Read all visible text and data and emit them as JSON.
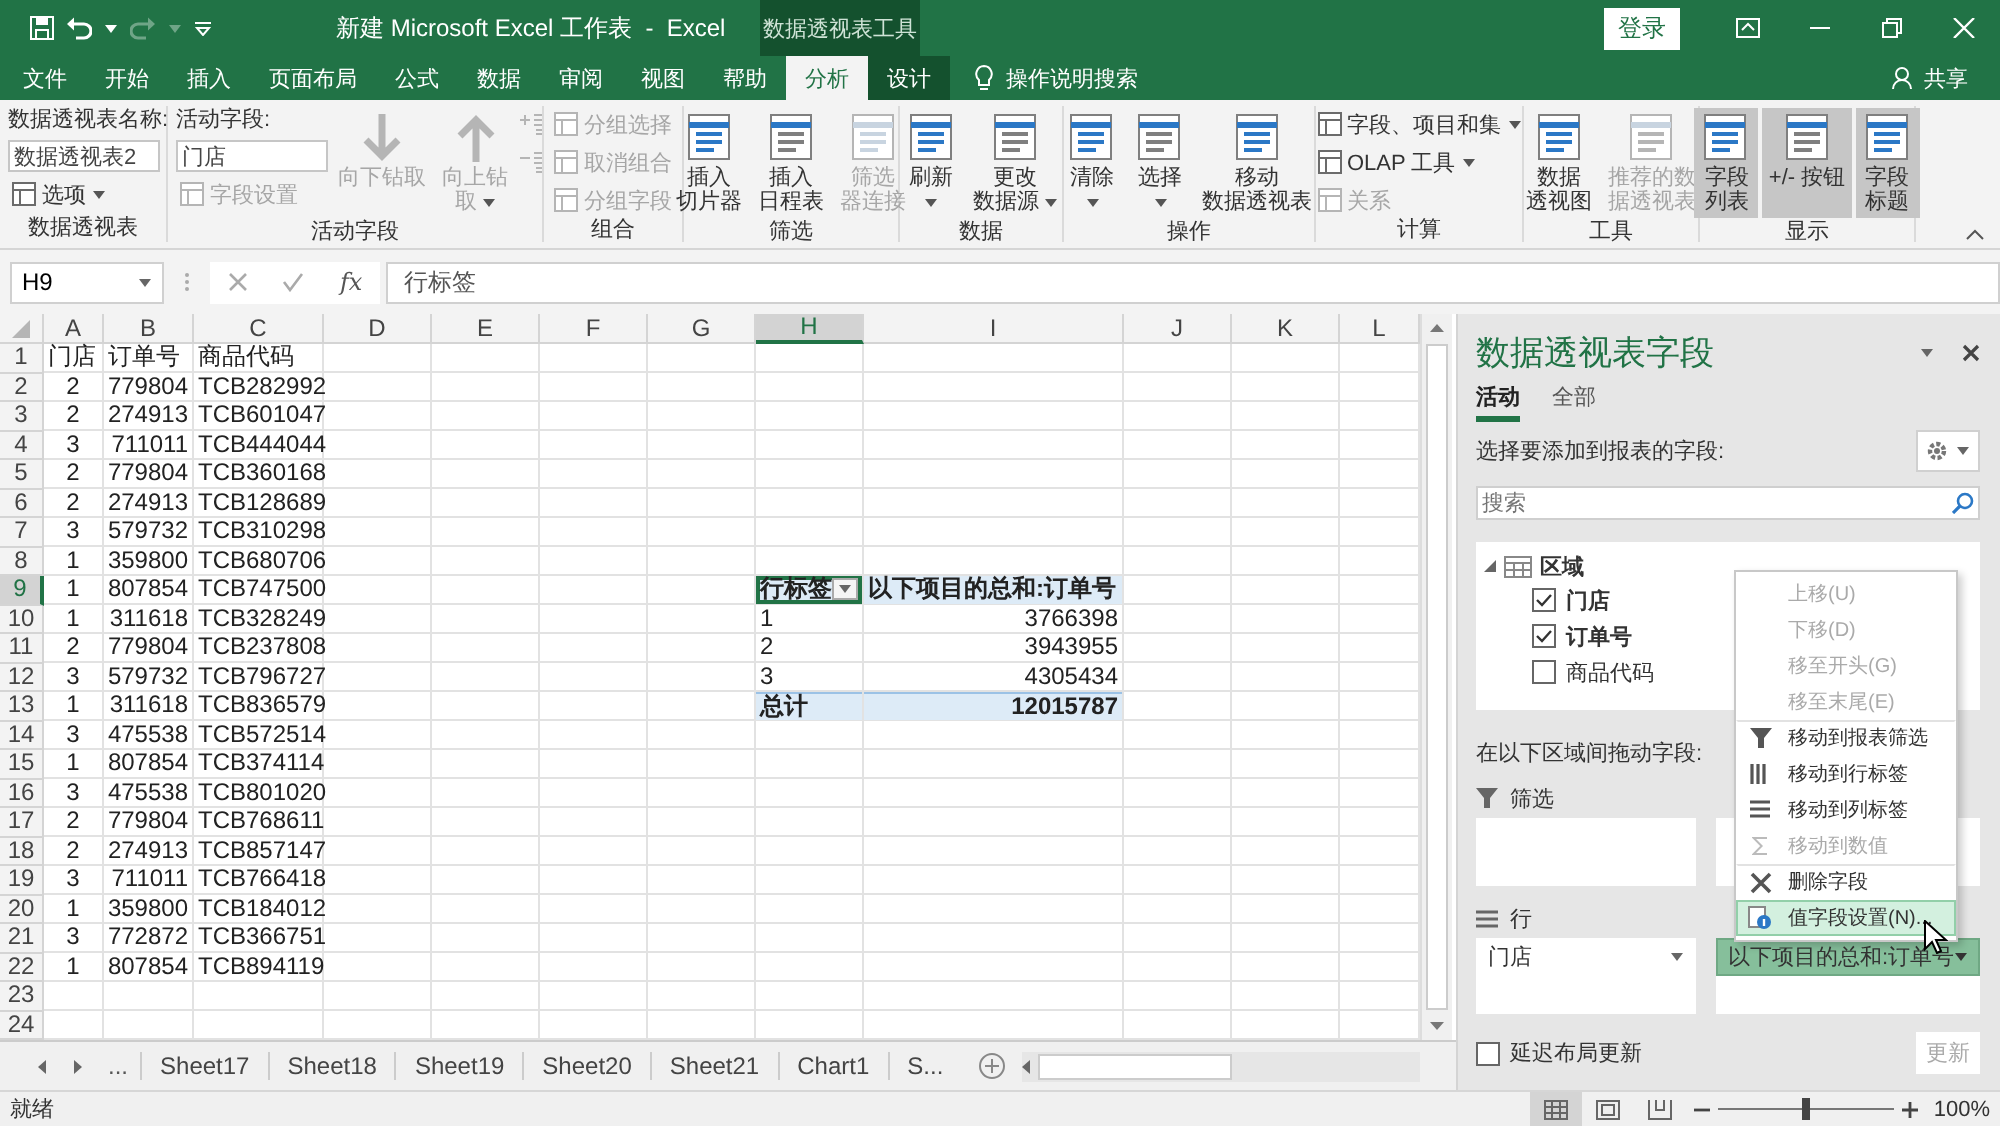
{
  "title_bar": {
    "title": "新建 Microsoft Excel 工作表  -  Excel",
    "contextual_group": "数据透视表工具",
    "sign_in": "登录"
  },
  "ribbon_tabs": [
    {
      "label": "文件",
      "selected": false,
      "contextual": false
    },
    {
      "label": "开始",
      "selected": false,
      "contextual": false
    },
    {
      "label": "插入",
      "selected": false,
      "contextual": false
    },
    {
      "label": "页面布局",
      "selected": false,
      "contextual": false
    },
    {
      "label": "公式",
      "selected": false,
      "contextual": false
    },
    {
      "label": "数据",
      "selected": false,
      "contextual": false
    },
    {
      "label": "审阅",
      "selected": false,
      "contextual": false
    },
    {
      "label": "视图",
      "selected": false,
      "contextual": false
    },
    {
      "label": "帮助",
      "selected": false,
      "contextual": false
    },
    {
      "label": "分析",
      "selected": true,
      "contextual": true
    },
    {
      "label": "设计",
      "selected": false,
      "contextual": true
    }
  ],
  "tell_me": "操作说明搜索",
  "share": "共享",
  "ribbon_groups": [
    {
      "label": "数据透视表",
      "controls": [
        {
          "kind": "label",
          "label": "数据透视表名称:"
        },
        {
          "kind": "field",
          "value": "数据透视表2"
        },
        {
          "kind": "small",
          "label": "选项",
          "dropdown": true,
          "disabled": false,
          "on": false
        }
      ]
    },
    {
      "label": "活动字段",
      "controls": [
        {
          "kind": "label",
          "label": "活动字段:"
        },
        {
          "kind": "field",
          "value": "门店"
        },
        {
          "kind": "small",
          "label": "字段设置",
          "dropdown": false,
          "disabled": true,
          "on": false
        },
        {
          "kind": "drilldown",
          "label_lines": [
            "向下钻取"
          ],
          "dropdown": false,
          "disabled": true,
          "on": false
        },
        {
          "kind": "drillup",
          "label_lines": [
            "向上钻",
            "取"
          ],
          "dropdown": true,
          "disabled": true,
          "on": false
        },
        {
          "kind": "expand",
          "disabled": true
        },
        {
          "kind": "collapse",
          "disabled": true
        }
      ]
    },
    {
      "label": "组合",
      "controls": [
        {
          "kind": "small",
          "label": "分组选择",
          "dropdown": false,
          "disabled": true,
          "on": false
        },
        {
          "kind": "small",
          "label": "取消组合",
          "dropdown": false,
          "disabled": true,
          "on": false
        },
        {
          "kind": "small",
          "label": "分组字段",
          "dropdown": false,
          "disabled": true,
          "on": false
        }
      ]
    },
    {
      "label": "筛选",
      "controls": [
        {
          "kind": "large",
          "label_lines": [
            "插入",
            "切片器"
          ],
          "dropdown": false,
          "disabled": false,
          "on": false
        },
        {
          "kind": "large",
          "label_lines": [
            "插入",
            "日程表"
          ],
          "dropdown": false,
          "disabled": false,
          "on": false
        },
        {
          "kind": "large",
          "label_lines": [
            "筛选",
            "器连接"
          ],
          "dropdown": false,
          "disabled": true,
          "on": false
        }
      ]
    },
    {
      "label": "数据",
      "controls": [
        {
          "kind": "large",
          "label_lines": [
            "刷新"
          ],
          "dropdown": true,
          "disabled": false,
          "on": false
        },
        {
          "kind": "large",
          "label_lines": [
            "更改",
            "数据源"
          ],
          "dropdown": true,
          "disabled": false,
          "on": false
        }
      ]
    },
    {
      "label": "操作",
      "controls": [
        {
          "kind": "large",
          "label_lines": [
            "清除"
          ],
          "dropdown": true,
          "disabled": false,
          "on": false
        },
        {
          "kind": "large",
          "label_lines": [
            "选择"
          ],
          "dropdown": true,
          "disabled": false,
          "on": false
        },
        {
          "kind": "large",
          "label_lines": [
            "移动",
            "数据透视表"
          ],
          "dropdown": false,
          "disabled": false,
          "on": false
        }
      ]
    },
    {
      "label": "计算",
      "controls": [
        {
          "kind": "small",
          "label": "字段、项目和集",
          "dropdown": true,
          "disabled": false,
          "on": false
        },
        {
          "kind": "small",
          "label": "OLAP 工具",
          "dropdown": true,
          "disabled": false,
          "on": false
        },
        {
          "kind": "small",
          "label": "关系",
          "dropdown": false,
          "disabled": true,
          "on": false
        }
      ]
    },
    {
      "label": "工具",
      "controls": [
        {
          "kind": "large",
          "label_lines": [
            "数据",
            "透视图"
          ],
          "dropdown": false,
          "disabled": false,
          "on": false
        },
        {
          "kind": "large",
          "label_lines": [
            "推荐的数",
            "据透视表"
          ],
          "dropdown": false,
          "disabled": true,
          "on": false
        }
      ]
    },
    {
      "label": "显示",
      "controls": [
        {
          "kind": "large",
          "label_lines": [
            "字段",
            "列表"
          ],
          "dropdown": false,
          "disabled": false,
          "on": true
        },
        {
          "kind": "large",
          "label_lines": [
            "+/- 按钮"
          ],
          "dropdown": false,
          "disabled": false,
          "on": true
        },
        {
          "kind": "large",
          "label_lines": [
            "字段",
            "标题"
          ],
          "dropdown": false,
          "disabled": false,
          "on": true
        }
      ]
    }
  ],
  "formula_bar": {
    "name_box": "H9",
    "fx": "fx",
    "formula": "行标签"
  },
  "sheet": {
    "columns": [
      {
        "label": "A",
        "selected": false
      },
      {
        "label": "B",
        "selected": false
      },
      {
        "label": "C",
        "selected": false
      },
      {
        "label": "D",
        "selected": false
      },
      {
        "label": "E",
        "selected": false
      },
      {
        "label": "F",
        "selected": false
      },
      {
        "label": "G",
        "selected": false
      },
      {
        "label": "H",
        "selected": true
      },
      {
        "label": "I",
        "selected": false
      },
      {
        "label": "J",
        "selected": false
      },
      {
        "label": "K",
        "selected": false
      },
      {
        "label": "L",
        "selected": false
      }
    ],
    "rows": [
      {
        "number": "1",
        "selected": false,
        "kind": "header",
        "cells": {
          "A": "门店",
          "B": "订单号",
          "C": "商品代码"
        }
      },
      {
        "number": "2",
        "selected": false,
        "kind": "data",
        "cells": {
          "A": "2",
          "B": "779804",
          "C": "TCB282992"
        }
      },
      {
        "number": "3",
        "selected": false,
        "kind": "data",
        "cells": {
          "A": "2",
          "B": "274913",
          "C": "TCB601047"
        }
      },
      {
        "number": "4",
        "selected": false,
        "kind": "data",
        "cells": {
          "A": "3",
          "B": "711011",
          "C": "TCB444044"
        }
      },
      {
        "number": "5",
        "selected": false,
        "kind": "data",
        "cells": {
          "A": "2",
          "B": "779804",
          "C": "TCB360168"
        }
      },
      {
        "number": "6",
        "selected": false,
        "kind": "data",
        "cells": {
          "A": "2",
          "B": "274913",
          "C": "TCB128689"
        }
      },
      {
        "number": "7",
        "selected": false,
        "kind": "data",
        "cells": {
          "A": "3",
          "B": "579732",
          "C": "TCB310298"
        }
      },
      {
        "number": "8",
        "selected": false,
        "kind": "data",
        "cells": {
          "A": "1",
          "B": "359800",
          "C": "TCB680706"
        }
      },
      {
        "number": "9",
        "selected": true,
        "kind": "pivothead",
        "cells": {
          "A": "1",
          "B": "807854",
          "C": "TCB747500",
          "H": "行标签",
          "I": "以下项目的总和:订单号"
        }
      },
      {
        "number": "10",
        "selected": false,
        "kind": "pivotitem",
        "cells": {
          "A": "1",
          "B": "311618",
          "C": "TCB328249",
          "H": "1",
          "I": "3766398"
        }
      },
      {
        "number": "11",
        "selected": false,
        "kind": "pivotitem",
        "cells": {
          "A": "2",
          "B": "779804",
          "C": "TCB237808",
          "H": "2",
          "I": "3943955"
        }
      },
      {
        "number": "12",
        "selected": false,
        "kind": "pivotitem",
        "cells": {
          "A": "3",
          "B": "579732",
          "C": "TCB796727",
          "H": "3",
          "I": "4305434"
        }
      },
      {
        "number": "13",
        "selected": false,
        "kind": "pivottotal",
        "cells": {
          "A": "1",
          "B": "311618",
          "C": "TCB836579",
          "H": "总计",
          "I": "12015787"
        }
      },
      {
        "number": "14",
        "selected": false,
        "kind": "data",
        "cells": {
          "A": "3",
          "B": "475538",
          "C": "TCB572514"
        }
      },
      {
        "number": "15",
        "selected": false,
        "kind": "data",
        "cells": {
          "A": "1",
          "B": "807854",
          "C": "TCB374114"
        }
      },
      {
        "number": "16",
        "selected": false,
        "kind": "data",
        "cells": {
          "A": "3",
          "B": "475538",
          "C": "TCB801020"
        }
      },
      {
        "number": "17",
        "selected": false,
        "kind": "data",
        "cells": {
          "A": "2",
          "B": "779804",
          "C": "TCB768611"
        }
      },
      {
        "number": "18",
        "selected": false,
        "kind": "data",
        "cells": {
          "A": "2",
          "B": "274913",
          "C": "TCB857147"
        }
      },
      {
        "number": "19",
        "selected": false,
        "kind": "data",
        "cells": {
          "A": "3",
          "B": "711011",
          "C": "TCB766418"
        }
      },
      {
        "number": "20",
        "selected": false,
        "kind": "data",
        "cells": {
          "A": "1",
          "B": "359800",
          "C": "TCB184012"
        }
      },
      {
        "number": "21",
        "selected": false,
        "kind": "data",
        "cells": {
          "A": "3",
          "B": "772872",
          "C": "TCB366751"
        }
      },
      {
        "number": "22",
        "selected": false,
        "kind": "data",
        "cells": {
          "A": "1",
          "B": "807854",
          "C": "TCB894119"
        }
      },
      {
        "number": "23",
        "selected": false,
        "kind": "data"
      },
      {
        "number": "24",
        "selected": false,
        "kind": "data"
      }
    ]
  },
  "sheet_tabs": {
    "more": "...",
    "tabs": [
      "Sheet17",
      "Sheet18",
      "Sheet19",
      "Sheet20",
      "Sheet21",
      "Chart1",
      "S..."
    ]
  },
  "field_panel": {
    "title": "数据透视表字段",
    "tabs": [
      {
        "label": "活动",
        "selected": true
      },
      {
        "label": "全部",
        "selected": false
      }
    ],
    "choose_label": "选择要添加到报表的字段:",
    "search": {
      "placeholder": "搜索"
    },
    "fields": [
      {
        "label": "区域",
        "expanded": true,
        "children": [
          {
            "label": "门店",
            "checked": true
          },
          {
            "label": "订单号",
            "checked": true
          },
          {
            "label": "商品代码",
            "checked": false
          }
        ]
      }
    ],
    "drag_label": "在以下区域间拖动字段:",
    "areas": [
      {
        "kind": "filters",
        "label": "筛选"
      },
      {
        "kind": "columns"
      },
      {
        "kind": "rows",
        "label": "行",
        "items": [
          {
            "label": "门店",
            "selected": false
          }
        ]
      },
      {
        "kind": "values",
        "items": [
          {
            "label": "以下项目的总和:订单号",
            "selected": true
          }
        ]
      }
    ],
    "defer": {
      "label": "延迟布局更新",
      "checked": false
    },
    "update_button": {
      "label": "更新",
      "disabled": true
    }
  },
  "context_menu": {
    "items": [
      {
        "kind": "plain",
        "label": "上移(U)",
        "disabled": true,
        "selected": false,
        "divider_above": false
      },
      {
        "kind": "plain",
        "label": "下移(D)",
        "disabled": true,
        "selected": false,
        "divider_above": false
      },
      {
        "kind": "plain",
        "label": "移至开头(G)",
        "disabled": true,
        "selected": false,
        "divider_above": false
      },
      {
        "kind": "plain",
        "label": "移至末尾(E)",
        "disabled": true,
        "selected": false,
        "divider_above": false
      },
      {
        "kind": "filter",
        "label": "移动到报表筛选",
        "disabled": false,
        "selected": false,
        "divider_above": true
      },
      {
        "kind": "rows",
        "label": "移动到行标签",
        "disabled": false,
        "selected": false,
        "divider_above": false
      },
      {
        "kind": "columns",
        "label": "移动到列标签",
        "disabled": false,
        "selected": false,
        "divider_above": false
      },
      {
        "kind": "values",
        "label": "移动到数值",
        "disabled": true,
        "selected": false,
        "divider_above": false
      },
      {
        "kind": "delete",
        "label": "删除字段",
        "disabled": false,
        "selected": false,
        "divider_above": true
      },
      {
        "kind": "settings",
        "label": "值字段设置(N)...",
        "disabled": false,
        "selected": true,
        "divider_above": false
      }
    ]
  },
  "status_bar": {
    "ready": "就绪",
    "views": [
      {
        "kind": "normal",
        "selected": true
      },
      {
        "kind": "layout",
        "selected": false
      },
      {
        "kind": "pagebreak",
        "selected": false
      }
    ],
    "zoom": {
      "level": 0.5,
      "reading": "100%"
    }
  }
}
